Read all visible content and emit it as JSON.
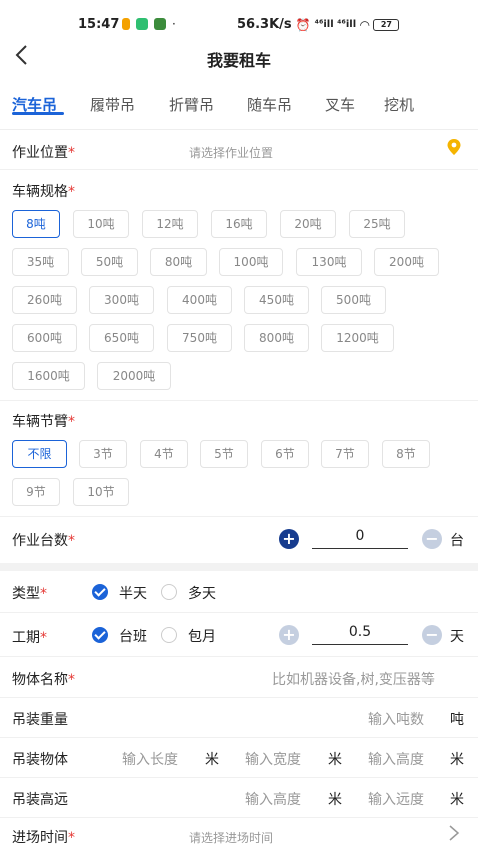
{
  "status_bar": {
    "time": "15:47",
    "speed": "56.3K/s",
    "signal_text": "⁴⁶ill ⁴⁶ill",
    "battery": "27"
  },
  "nav": {
    "title": "我要租车"
  },
  "tabs": [
    "汽车吊",
    "履带吊",
    "折臂吊",
    "随车吊",
    "叉车",
    "挖机"
  ],
  "work_location": {
    "label": "作业位置",
    "placeholder": "请选择作业位置"
  },
  "vehicle_spec": {
    "label": "车辆规格",
    "options": [
      "8吨",
      "10吨",
      "12吨",
      "16吨",
      "20吨",
      "25吨",
      "35吨",
      "50吨",
      "80吨",
      "100吨",
      "130吨",
      "200吨",
      "260吨",
      "300吨",
      "400吨",
      "450吨",
      "500吨",
      "600吨",
      "650吨",
      "750吨",
      "800吨",
      "1200吨",
      "1600吨",
      "2000吨"
    ],
    "selected": "8吨"
  },
  "vehicle_arm": {
    "label": "车辆节臂",
    "options": [
      "不限",
      "3节",
      "4节",
      "5节",
      "6节",
      "7节",
      "8节",
      "9节",
      "10节"
    ],
    "selected": "不限"
  },
  "work_units": {
    "label": "作业台数",
    "value": "0",
    "unit": "台",
    "plus": "+",
    "minus": "−"
  },
  "type": {
    "label": "类型",
    "options": [
      "半天",
      "多天"
    ],
    "selected": "半天"
  },
  "period": {
    "label": "工期",
    "options": [
      "台班",
      "包月"
    ],
    "selected": "台班",
    "value": "0.5",
    "unit": "天",
    "plus": "+",
    "minus": "−"
  },
  "object_name": {
    "label": "物体名称",
    "placeholder": "比如机器设备,树,变压器等"
  },
  "lift_weight": {
    "label": "吊装重量",
    "placeholder": "输入吨数",
    "unit": "吨"
  },
  "lift_object": {
    "label": "吊装物体",
    "length_ph": "输入长度",
    "width_ph": "输入宽度",
    "height_ph": "输入高度",
    "unit": "米"
  },
  "lift_height": {
    "label": "吊装高远",
    "height_ph": "输入高度",
    "distance_ph": "输入远度",
    "unit": "米"
  },
  "entry_time": {
    "label": "进场时间",
    "placeholder": "请选择进场时间"
  },
  "required_mark": "*",
  "colors": {
    "accent": "#1b63d8",
    "required": "#e53935",
    "dark_button": "#173c8e",
    "location_icon": "#f5b400"
  }
}
